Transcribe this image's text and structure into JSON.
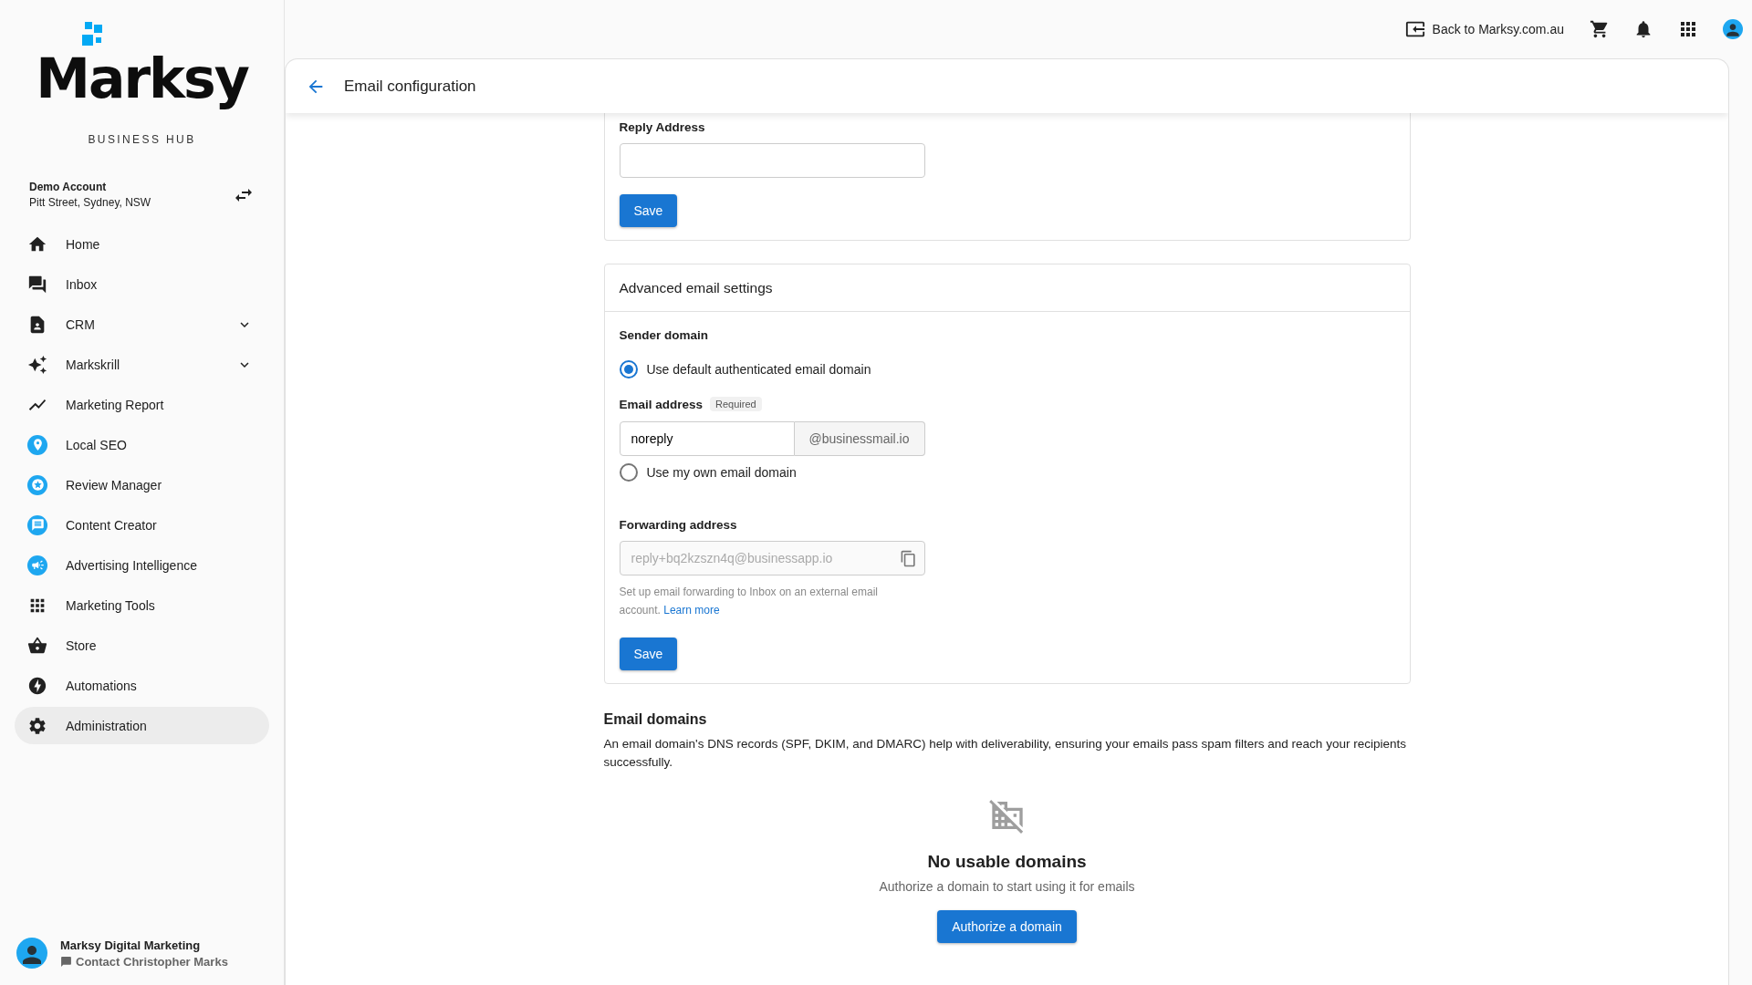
{
  "brand": {
    "logo_text": "Marksy",
    "subtitle": "BUSINESS HUB"
  },
  "account": {
    "name": "Demo Account",
    "address": "Pitt Street, Sydney, NSW"
  },
  "sidebar": {
    "items": [
      {
        "label": "Home",
        "kind": "link",
        "selected": false
      },
      {
        "label": "Inbox",
        "kind": "link",
        "selected": false
      },
      {
        "label": "CRM",
        "kind": "group",
        "selected": false
      },
      {
        "label": "Markskrill",
        "kind": "group",
        "selected": false
      },
      {
        "label": "Marketing Report",
        "kind": "link",
        "selected": false
      },
      {
        "label": "Local SEO",
        "kind": "link",
        "selected": false
      },
      {
        "label": "Review Manager",
        "kind": "link",
        "selected": false
      },
      {
        "label": "Content Creator",
        "kind": "link",
        "selected": false
      },
      {
        "label": "Advertising Intelligence",
        "kind": "link",
        "selected": false
      },
      {
        "label": "Marketing Tools",
        "kind": "link",
        "selected": false
      },
      {
        "label": "Store",
        "kind": "link",
        "selected": false
      },
      {
        "label": "Automations",
        "kind": "link",
        "selected": false
      },
      {
        "label": "Administration",
        "kind": "link",
        "selected": true
      }
    ]
  },
  "profile": {
    "name": "Marksy Digital Marketing",
    "contact": "Contact Christopher Marks"
  },
  "topbar": {
    "back_link": "Back to Marksy.com.au"
  },
  "page": {
    "title": "Email configuration"
  },
  "reply_card": {
    "label": "Reply Address",
    "button": "Save"
  },
  "advanced_card": {
    "title": "Advanced email settings",
    "sender_label": "Sender domain",
    "options": [
      {
        "label": "Use default authenticated email domain",
        "selected": true,
        "field": {
          "label": "Email address",
          "badge": "Required",
          "value": "noreply",
          "suffix": "@businessmail.io"
        }
      },
      {
        "label": "Use my own email domain",
        "selected": false
      }
    ],
    "forwarding": {
      "label": "Forwarding address",
      "value": "reply+bq2kzszn4q@businessapp.io",
      "help": "Set up email forwarding to Inbox on an external email account.",
      "link": "Learn more"
    },
    "button": "Save"
  },
  "domains": {
    "title": "Email domains",
    "description": "An email domain's DNS records (SPF, DKIM, and DMARC) help with deliverability, ensuring your emails pass spam filters and reach your recipients successfully.",
    "empty_title": "No usable domains",
    "empty_text": "Authorize a domain to start using it for emails",
    "button": "Authorize a domain"
  }
}
